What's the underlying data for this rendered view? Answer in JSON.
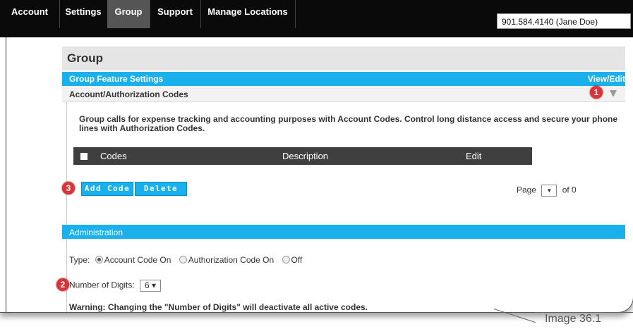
{
  "nav": {
    "items": [
      {
        "label": "Account"
      },
      {
        "label": "Settings"
      },
      {
        "label": "Group"
      },
      {
        "label": "Support"
      },
      {
        "label": "Manage Locations"
      }
    ],
    "active": "Group",
    "user_select": "901.584.4140 (Jane Doe)"
  },
  "group": {
    "title": "Group",
    "feature_settings": "Group Feature Settings",
    "view_edit": "View/Edit",
    "section_title": "Account/Authorization Codes",
    "description": "Group calls for expense tracking and accounting purposes with Account Codes. Control long distance access and secure your phone lines with Authorization Codes."
  },
  "table": {
    "columns": [
      "Codes",
      "Description",
      "Edit"
    ]
  },
  "buttons": {
    "add_code": "Add Code",
    "delete": "Delete"
  },
  "pager": {
    "label": "Page",
    "of": "of 0",
    "select_glyph": "▼"
  },
  "admin": {
    "title": "Administration",
    "type_label": "Type:",
    "options": [
      "Account Code On",
      "Authorization Code On",
      "Off"
    ],
    "selected_option": "Account Code On",
    "digits_label": "Number of Digits:",
    "digits_value": "6 ▾",
    "warning": "Warning: Changing the \"Number of Digits\" will deactivate all active codes."
  },
  "badges": [
    "1",
    "2",
    "3"
  ],
  "caption": "Image 36.1",
  "colors": {
    "accent_blue": "#1ab0ec",
    "nav_bg": "#0a0a0a",
    "badge_red": "#d9343a",
    "table_header": "#3f3f3f"
  }
}
